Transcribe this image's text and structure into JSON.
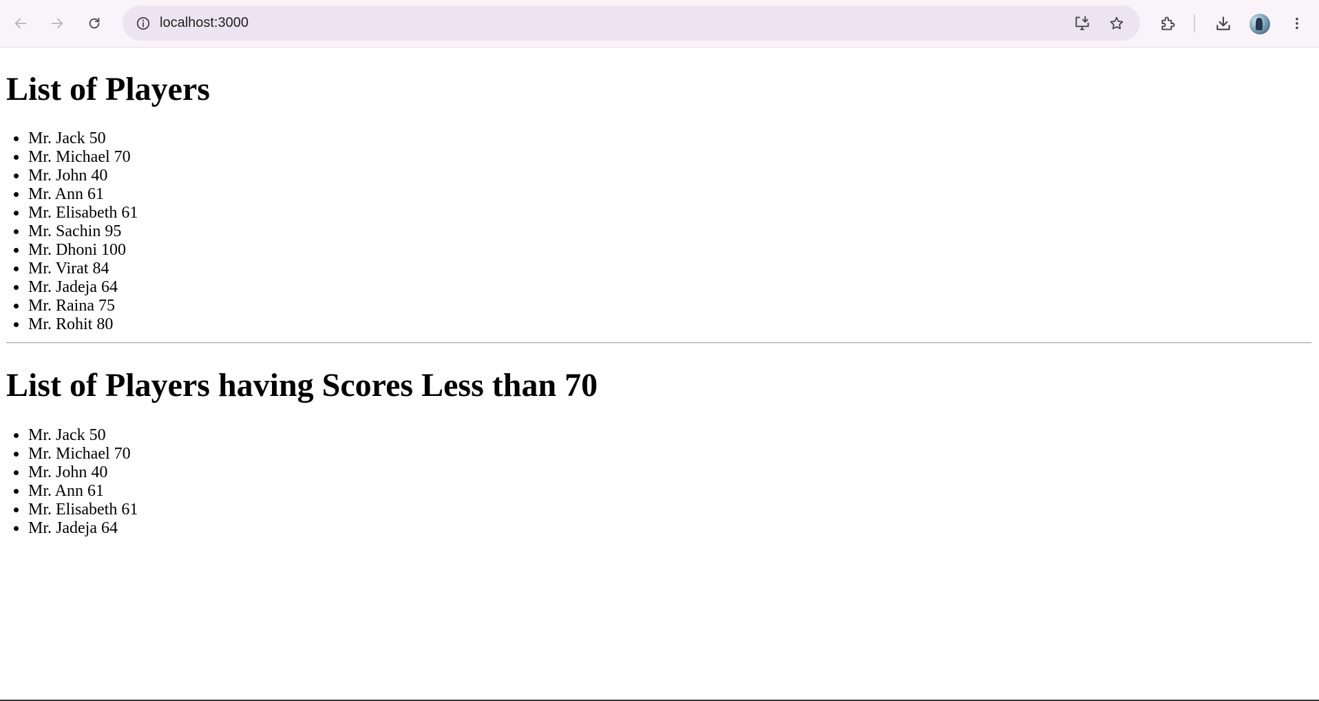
{
  "browser": {
    "url": "localhost:3000",
    "icons": {
      "back": "arrow-left-icon",
      "forward": "arrow-right-icon",
      "reload": "reload-icon",
      "site_info": "info-icon",
      "install": "install-app-icon",
      "bookmark": "star-icon",
      "extensions": "puzzle-icon",
      "downloads": "download-icon",
      "menu": "kebab-menu-icon"
    }
  },
  "main": {
    "heading_all": "List of Players",
    "players_all": [
      "Mr. Jack 50",
      "Mr. Michael 70",
      "Mr. John 40",
      "Mr. Ann 61",
      "Mr. Elisabeth 61",
      "Mr. Sachin 95",
      "Mr. Dhoni 100",
      "Mr. Virat 84",
      "Mr. Jadeja 64",
      "Mr. Raina 75",
      "Mr. Rohit 80"
    ],
    "heading_filtered": "List of Players having Scores Less than 70",
    "players_filtered": [
      "Mr. Jack 50",
      "Mr. Michael 70",
      "Mr. John 40",
      "Mr. Ann 61",
      "Mr. Elisabeth 61",
      "Mr. Jadeja 64"
    ]
  }
}
